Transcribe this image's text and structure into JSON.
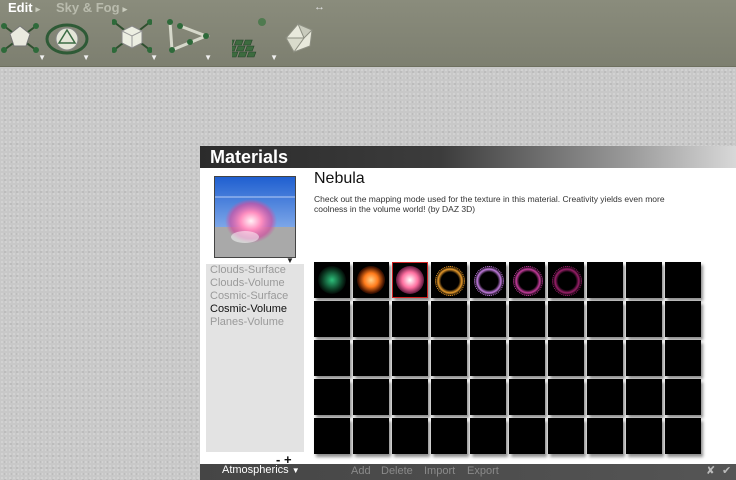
{
  "toolbar": {
    "menu_edit": "Edit",
    "menu_sky_fog": "Sky & Fog",
    "caret": "▸",
    "resize_glyph": "↔",
    "tools": [
      {
        "name": "create-light-tool",
        "icon": "light-icon"
      },
      {
        "name": "sphere-tool",
        "icon": "sphere-icon"
      },
      {
        "name": "cube-tool",
        "icon": "cube-icon"
      },
      {
        "name": "path-tool",
        "icon": "path-icon"
      },
      {
        "name": "terrain-grid-tool",
        "icon": "grid-tiles-icon"
      },
      {
        "name": "rock-tool",
        "icon": "rock-icon"
      }
    ],
    "dropdown_glyph": "▼"
  },
  "materials": {
    "title": "Materials",
    "material_name": "Nebula",
    "description": "Check out the mapping mode used for the texture in this material.  Creativity yields even more coolness in the volume world! (by DAZ 3D)",
    "preview_menu_glyph": "▼",
    "categories": [
      "Clouds-Surface",
      "Clouds-Volume",
      "Cosmic-Surface",
      "Cosmic-Volume",
      "Planes-Volume"
    ],
    "active_category": "Cosmic-Volume",
    "minus": "-",
    "plus": "+",
    "thumbnails": [
      {
        "color": "#2dbf7a",
        "style": "speckle"
      },
      {
        "color": "#ff7a1a",
        "style": "burst"
      },
      {
        "color": "#ff6fa0",
        "style": "nebula",
        "selected": true
      },
      {
        "color": "#e89a2a",
        "style": "ring"
      },
      {
        "color": "#c27adf",
        "style": "ring"
      },
      {
        "color": "#c43b9c",
        "style": "ring"
      },
      {
        "color": "#9a1f6a",
        "style": "ring"
      }
    ],
    "empty_slots": 43
  },
  "footer": {
    "library": "Atmospherics",
    "library_caret": "▼",
    "add": "Add",
    "delete": "Delete",
    "import": "Import",
    "export": "Export",
    "cancel_glyph": "✘",
    "ok_glyph": "✔"
  }
}
